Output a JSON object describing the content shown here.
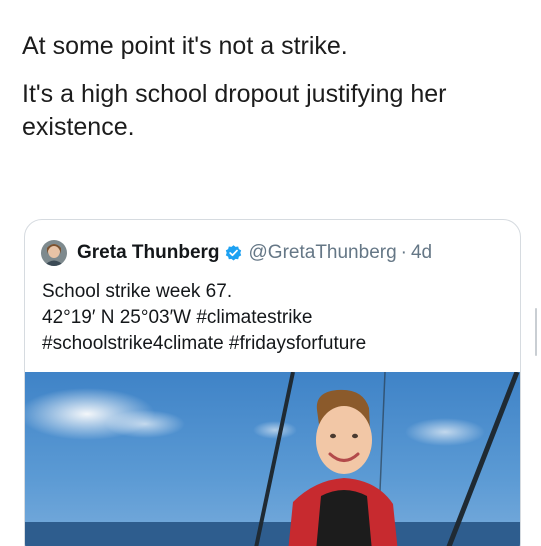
{
  "tweet": {
    "lines": [
      "At some point it's not a strike.",
      "It's a high school dropout justifying her existence."
    ]
  },
  "quoted_tweet": {
    "display_name": "Greta Thunberg",
    "handle": "@GretaThunberg",
    "separator": "·",
    "age": "4d",
    "verified": true,
    "avatar_icon": "profile-photo",
    "body_lines": [
      "School strike week 67.",
      "42°19′ N 25°03′W #climatestrike",
      "#schoolstrike4climate #fridaysforfuture"
    ],
    "media": "photo of a girl smiling on a sailboat under blue sky"
  },
  "colors": {
    "text": "#14171a",
    "secondary": "#657786",
    "verified": "#1da1f2",
    "card_border": "#d6dbe0"
  }
}
